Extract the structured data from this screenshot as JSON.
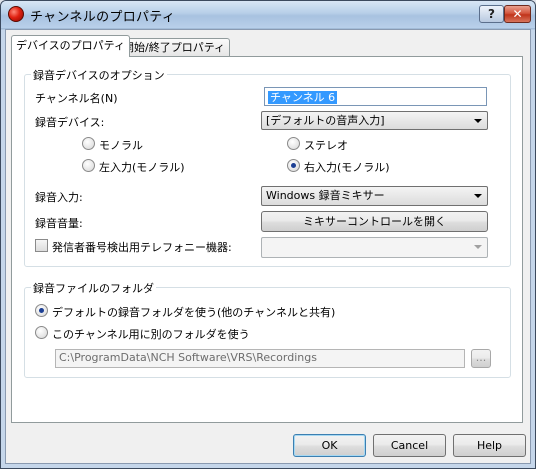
{
  "window": {
    "title": "チャンネルのプロパティ",
    "help_label": "?",
    "close_label": "✕"
  },
  "tabs": [
    {
      "label": "デバイスのプロパティ",
      "active": true
    },
    {
      "label": "開始/終了プロパティ",
      "active": false
    }
  ],
  "device_group": {
    "title": "録音デバイスのオプション",
    "channel_name_label": "チャンネル名(N)",
    "channel_name_value": "チャンネル 6",
    "recording_device_label": "録音デバイス:",
    "recording_device_value": "[デフォルトの音声入力]",
    "radio_options": [
      {
        "label": "モノラル",
        "checked": false
      },
      {
        "label": "ステレオ",
        "checked": false
      },
      {
        "label": "左入力(モノラル)",
        "checked": false
      },
      {
        "label": "右入力(モノラル)",
        "checked": true
      }
    ],
    "recording_input_label": "録音入力:",
    "recording_input_value": "Windows 録音ミキサー",
    "recording_volume_label": "録音音量:",
    "mixer_button_label": "ミキサーコントロールを開く",
    "caller_id_label": "発信者番号検出用テレフォニー機器:",
    "caller_id_checked": false,
    "caller_id_value": ""
  },
  "folder_group": {
    "title": "録音ファイルのフォルダ",
    "default_folder_label": "デフォルトの録音フォルダを使う(他のチャンネルと共有)",
    "default_folder_checked": true,
    "custom_folder_label": "このチャンネル用に別のフォルダを使う",
    "custom_folder_checked": false,
    "folder_path": "C:\\ProgramData\\NCH Software\\VRS\\Recordings",
    "browse_label": "..."
  },
  "buttons": {
    "ok": "OK",
    "cancel": "Cancel",
    "help": "Help"
  }
}
